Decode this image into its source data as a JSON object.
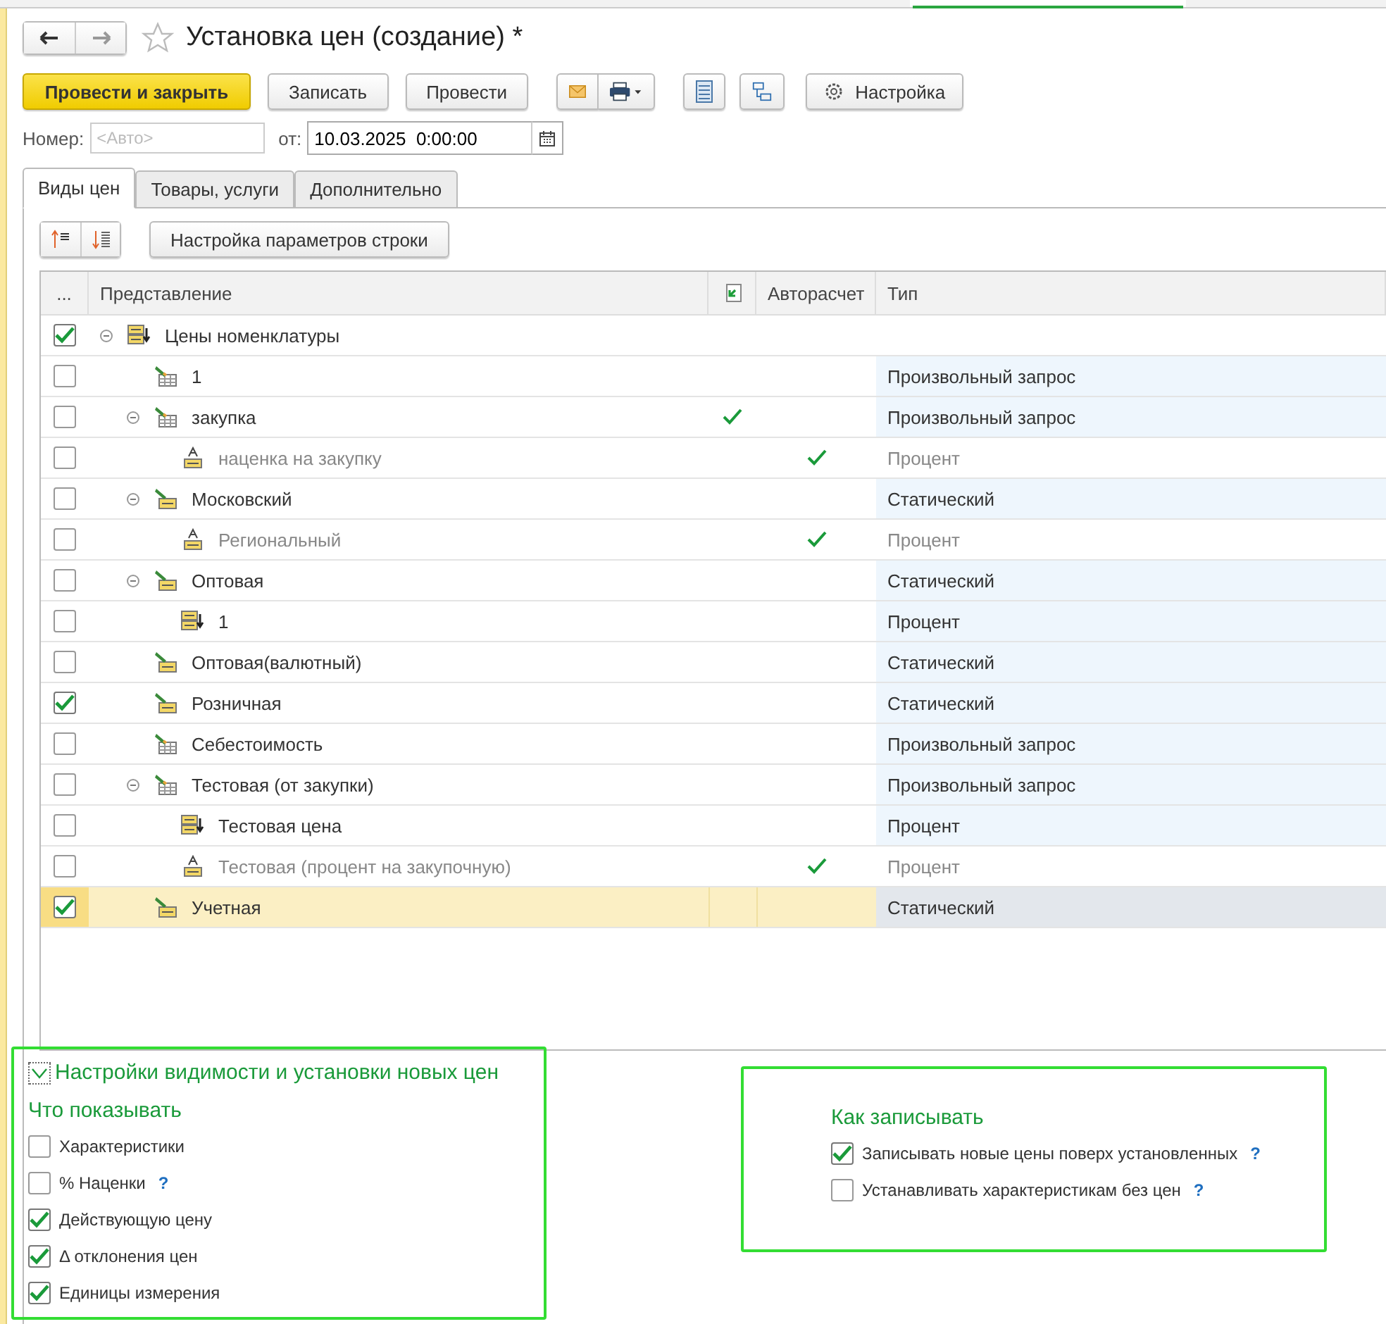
{
  "window": {
    "title": "Установка цен (создание) *"
  },
  "toolbar": [
    {
      "kind": "primary",
      "label": "Провести и закрыть"
    },
    {
      "kind": "plain",
      "label": "Записать"
    },
    {
      "kind": "plain",
      "label": "Провести"
    },
    {
      "kind": "mail"
    },
    {
      "kind": "print"
    },
    {
      "kind": "list"
    },
    {
      "kind": "structure"
    },
    {
      "kind": "settings",
      "label": "Настройка"
    }
  ],
  "number": {
    "label": "Номер:",
    "placeholder": "<Авто>"
  },
  "date": {
    "label": "от:",
    "value": "10.03.2025  0:00:00"
  },
  "tabs": [
    {
      "label": "Виды цен",
      "selected": true
    },
    {
      "label": "Товары, услуги",
      "selected": false
    },
    {
      "label": "Дополнительно",
      "selected": false
    }
  ],
  "row_settings_button": "Настройка параметров строки",
  "table": {
    "columns": [
      {
        "kind": "text",
        "label": "..."
      },
      {
        "kind": "text",
        "label": "Представление"
      },
      {
        "kind": "icon"
      },
      {
        "kind": "text",
        "label": "Авторасчет"
      },
      {
        "kind": "text",
        "label": "Тип"
      }
    ],
    "rows": [
      {
        "label": "Цены номенклатуры",
        "checked": true,
        "kind": "price-stack",
        "muted": false,
        "marked": false,
        "autocalc": false,
        "selected": false,
        "expanded": true,
        "children": [
          {
            "label": "1",
            "checked": false,
            "kind": "pencil-table",
            "muted": false,
            "marked": false,
            "autocalc": false,
            "selected": false,
            "type": "Произвольный запрос"
          },
          {
            "label": "закупка",
            "checked": false,
            "kind": "pencil-table",
            "muted": false,
            "marked": true,
            "autocalc": false,
            "selected": false,
            "type": "Произвольный запрос",
            "expanded": true,
            "children": [
              {
                "label": "наценка на закупку",
                "checked": false,
                "kind": "percent",
                "muted": true,
                "marked": false,
                "autocalc": true,
                "selected": false,
                "type": "Процент"
              }
            ]
          },
          {
            "label": "Московский",
            "checked": false,
            "kind": "pencil-price",
            "muted": false,
            "marked": false,
            "autocalc": false,
            "selected": false,
            "type": "Статический",
            "expanded": true,
            "children": [
              {
                "label": "Региональный",
                "checked": false,
                "kind": "percent",
                "muted": true,
                "marked": false,
                "autocalc": true,
                "selected": false,
                "type": "Процент"
              }
            ]
          },
          {
            "label": "Оптовая",
            "checked": false,
            "kind": "pencil-price",
            "muted": false,
            "marked": false,
            "autocalc": false,
            "selected": false,
            "type": "Статический",
            "expanded": true,
            "children": [
              {
                "label": "1",
                "checked": false,
                "kind": "price-stack",
                "muted": false,
                "marked": false,
                "autocalc": false,
                "selected": false,
                "type": "Процент"
              }
            ]
          },
          {
            "label": "Оптовая(валютный)",
            "checked": false,
            "kind": "pencil-price",
            "muted": false,
            "marked": false,
            "autocalc": false,
            "selected": false,
            "type": "Статический"
          },
          {
            "label": "Розничная",
            "checked": true,
            "kind": "pencil-price",
            "muted": false,
            "marked": false,
            "autocalc": false,
            "selected": false,
            "type": "Статический"
          },
          {
            "label": "Себестоимость",
            "checked": false,
            "kind": "pencil-table",
            "muted": false,
            "marked": false,
            "autocalc": false,
            "selected": false,
            "type": "Произвольный запрос"
          },
          {
            "label": "Тестовая (от закупки)",
            "checked": false,
            "kind": "pencil-table",
            "muted": false,
            "marked": false,
            "autocalc": false,
            "selected": false,
            "type": "Произвольный запрос",
            "expanded": true,
            "children": [
              {
                "label": "Тестовая цена",
                "checked": false,
                "kind": "price-stack",
                "muted": false,
                "marked": false,
                "autocalc": false,
                "selected": false,
                "type": "Процент"
              },
              {
                "label": "Тестовая (процент на закупочную)",
                "checked": false,
                "kind": "percent",
                "muted": true,
                "marked": false,
                "autocalc": true,
                "selected": false,
                "type": "Процент"
              }
            ]
          },
          {
            "label": "Учетная",
            "checked": true,
            "kind": "pencil-price",
            "muted": false,
            "marked": false,
            "autocalc": false,
            "selected": true,
            "type": "Статический"
          }
        ]
      }
    ]
  },
  "visibility": {
    "title": "Настройки видимости и установки новых цен",
    "expanded": true,
    "section": "Что показывать",
    "options": [
      {
        "label": "Характеристики",
        "checked": false
      },
      {
        "label": "% Наценки",
        "checked": false,
        "help": "?"
      },
      {
        "label": "Действующую цену",
        "checked": true
      },
      {
        "label": "Δ отклонения цен",
        "checked": true
      },
      {
        "label": "Единицы измерения",
        "checked": true
      }
    ]
  },
  "write_mode": {
    "section": "Как записывать",
    "options": [
      {
        "label": "Записывать новые цены поверх установленных",
        "checked": true,
        "help": "?"
      },
      {
        "label": "Устанавливать характеристикам без цен",
        "checked": false,
        "help": "?"
      }
    ]
  }
}
